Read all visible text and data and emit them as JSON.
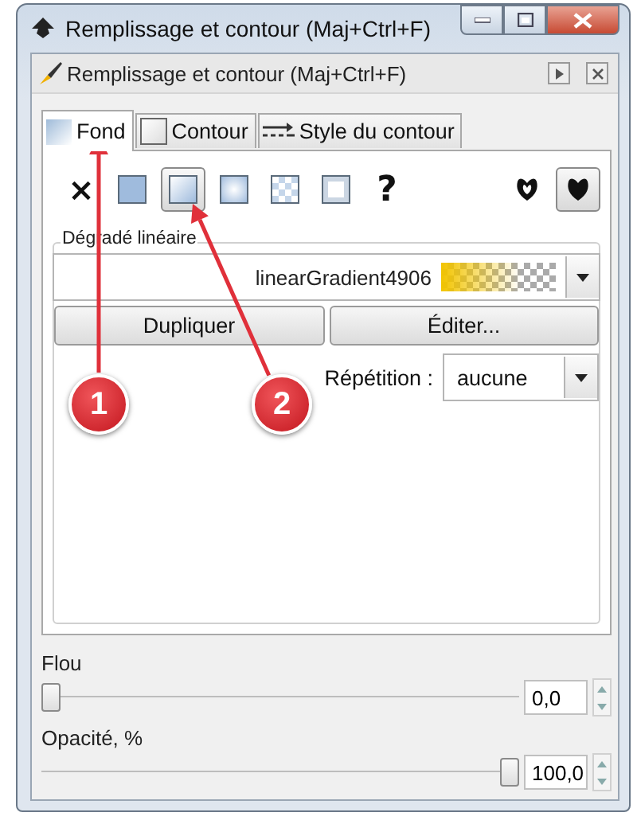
{
  "window": {
    "title": "Remplissage et contour (Maj+Ctrl+F)"
  },
  "panel": {
    "title": "Remplissage et contour (Maj+Ctrl+F)"
  },
  "tabs": [
    {
      "label": "Fond",
      "kind": "fill",
      "selected": true
    },
    {
      "label": "Contour",
      "kind": "stroke",
      "selected": false
    },
    {
      "label": "Style du contour",
      "kind": "style",
      "selected": false
    }
  ],
  "paint_types": [
    {
      "kind": "none",
      "label": "×",
      "selected": false
    },
    {
      "kind": "flat",
      "selected": false
    },
    {
      "kind": "linear",
      "selected": true
    },
    {
      "kind": "radial",
      "selected": false
    },
    {
      "kind": "pattern",
      "selected": false
    },
    {
      "kind": "swatch",
      "selected": false
    },
    {
      "kind": "unset",
      "label": "?",
      "selected": false
    }
  ],
  "fill_rules": [
    {
      "kind": "evenodd",
      "selected": false
    },
    {
      "kind": "nonzero",
      "selected": true
    }
  ],
  "gradient": {
    "title": "Dégradé linéaire",
    "name": "linearGradient4906",
    "buttons": [
      "Dupliquer",
      "Éditer..."
    ],
    "repeat_label": "Répétition :",
    "repeat_value": "aucune"
  },
  "sliders": [
    {
      "label": "Flou",
      "value": "0,0",
      "level": 0
    },
    {
      "label": "Opacité, %",
      "value": "100,0",
      "level": 1
    }
  ],
  "callouts": [
    {
      "number": "1"
    },
    {
      "number": "2"
    }
  ]
}
